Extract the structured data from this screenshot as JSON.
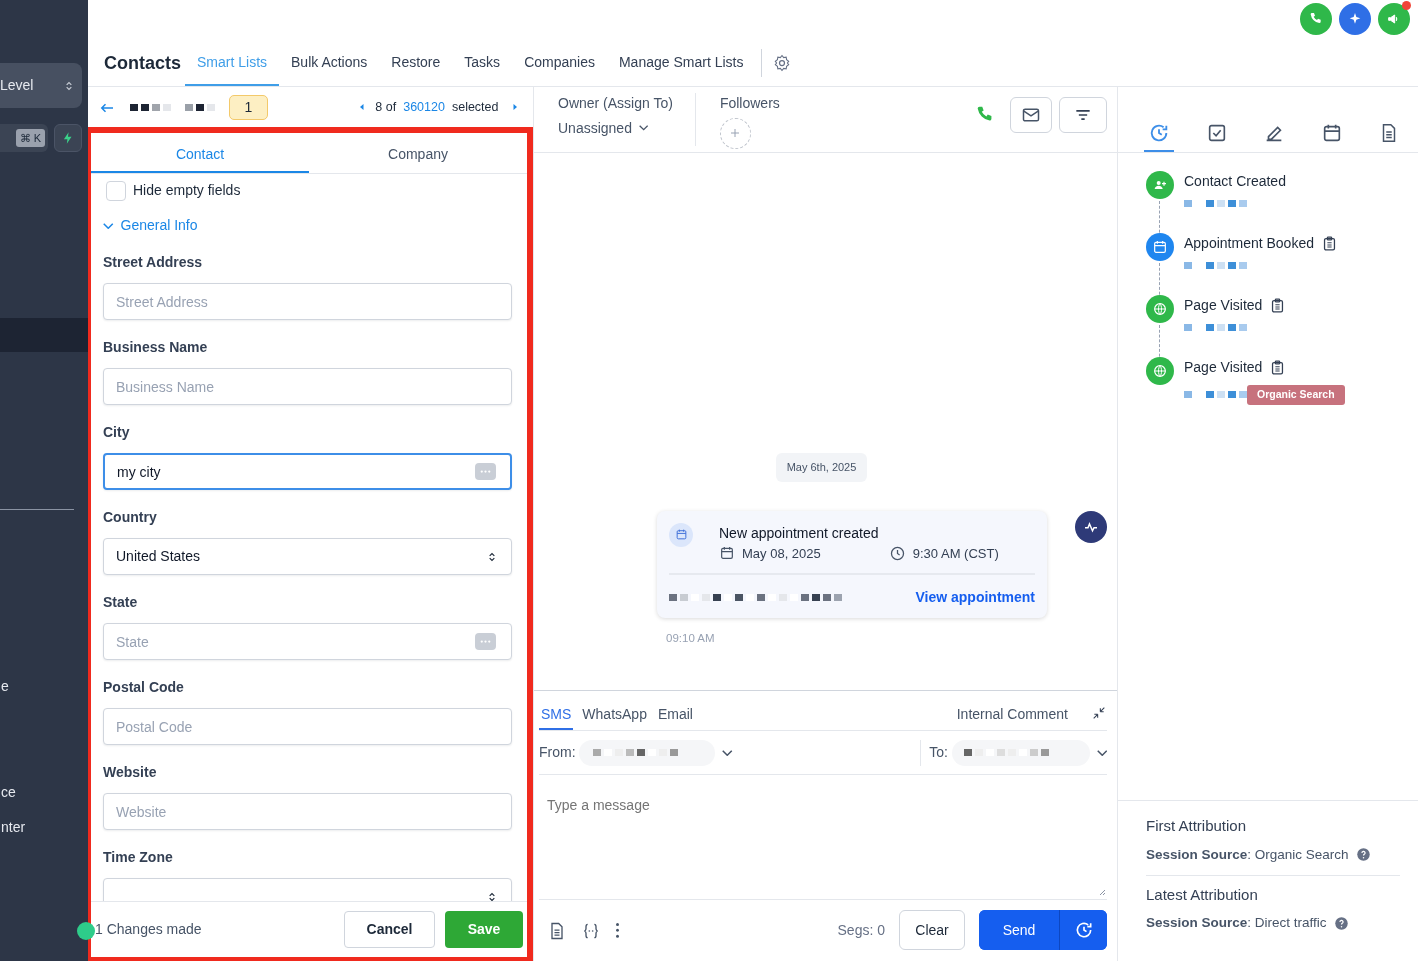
{
  "sidebar": {
    "location_switcher": "Level",
    "search_shortcut": "⌘ K",
    "items": [
      "e",
      "ce",
      "nter"
    ]
  },
  "header": {
    "title": "Contacts",
    "tabs": [
      {
        "label": "Smart Lists",
        "selected": true
      },
      {
        "label": "Bulk Actions",
        "selected": false
      },
      {
        "label": "Restore",
        "selected": false
      },
      {
        "label": "Tasks",
        "selected": false
      },
      {
        "label": "Companies",
        "selected": false
      },
      {
        "label": "Manage Smart Lists",
        "selected": false
      }
    ],
    "notification": true
  },
  "record_bar": {
    "count_badge": "1",
    "pager_position": "8 of",
    "pager_total": "360120",
    "pager_suffix": "selected"
  },
  "form": {
    "tabs": [
      {
        "label": "Contact",
        "selected": true
      },
      {
        "label": "Company",
        "selected": false
      }
    ],
    "hide_empty": {
      "label": "Hide empty fields",
      "checked": false
    },
    "section": {
      "label": "General Info",
      "expanded": true
    },
    "fields": [
      {
        "label": "Street Address",
        "kind": "text",
        "placeholder": "Street Address",
        "focused": false
      },
      {
        "label": "Business Name",
        "kind": "text",
        "placeholder": "Business Name",
        "focused": false
      },
      {
        "label": "City",
        "kind": "options",
        "value": "my city",
        "focused": true
      },
      {
        "label": "Country",
        "kind": "select",
        "value": "United States",
        "focused": false
      },
      {
        "label": "State",
        "kind": "options",
        "placeholder": "State",
        "focused": false
      },
      {
        "label": "Postal Code",
        "kind": "text",
        "placeholder": "Postal Code",
        "focused": false
      },
      {
        "label": "Website",
        "kind": "text",
        "placeholder": "Website",
        "focused": false
      },
      {
        "label": "Time Zone",
        "kind": "select",
        "focused": false
      }
    ],
    "changes": "1 Changes made",
    "cancel": "Cancel",
    "save": "Save"
  },
  "conversation": {
    "owner_label": "Owner (Assign To)",
    "owner_value": "Unassigned",
    "followers_label": "Followers",
    "date_chip": "May 6th, 2025",
    "event": {
      "title": "New appointment created",
      "date": "May 08, 2025",
      "time": "9:30 AM (CST)",
      "link": "View appointment",
      "timestamp": "09:10 AM"
    }
  },
  "composer": {
    "channels": [
      {
        "label": "SMS",
        "selected": true
      },
      {
        "label": "WhatsApp",
        "selected": false
      },
      {
        "label": "Email",
        "selected": false
      }
    ],
    "internal_comment": "Internal Comment",
    "from_label": "From:",
    "to_label": "To:",
    "placeholder": "Type a message",
    "segments": "Segs: 0",
    "clear": "Clear",
    "send": "Send"
  },
  "activity": {
    "tabs": [
      {
        "kind": "history",
        "selected": true
      },
      {
        "kind": "tasks",
        "selected": false
      },
      {
        "kind": "notes",
        "selected": false
      },
      {
        "kind": "calendar",
        "selected": false
      },
      {
        "kind": "documents",
        "selected": false
      }
    ],
    "timeline": [
      {
        "title": "Contact Created",
        "kind": "contact",
        "color": "#2fb84a",
        "has_notes": false
      },
      {
        "title": "Appointment Booked",
        "kind": "appointment",
        "color": "#1f86ef",
        "has_notes": true
      },
      {
        "title": "Page Visited",
        "kind": "page",
        "color": "#2fb84a",
        "has_notes": true
      },
      {
        "title": "Page Visited",
        "kind": "page",
        "color": "#2fb84a",
        "has_notes": true,
        "tag": "Organic Search"
      }
    ],
    "attribution": [
      {
        "title": "First Attribution",
        "text": "**Session Source**: Organic Search"
      },
      {
        "title": "Latest Attribution",
        "text": "**Session Source**: Direct traffic"
      }
    ]
  }
}
